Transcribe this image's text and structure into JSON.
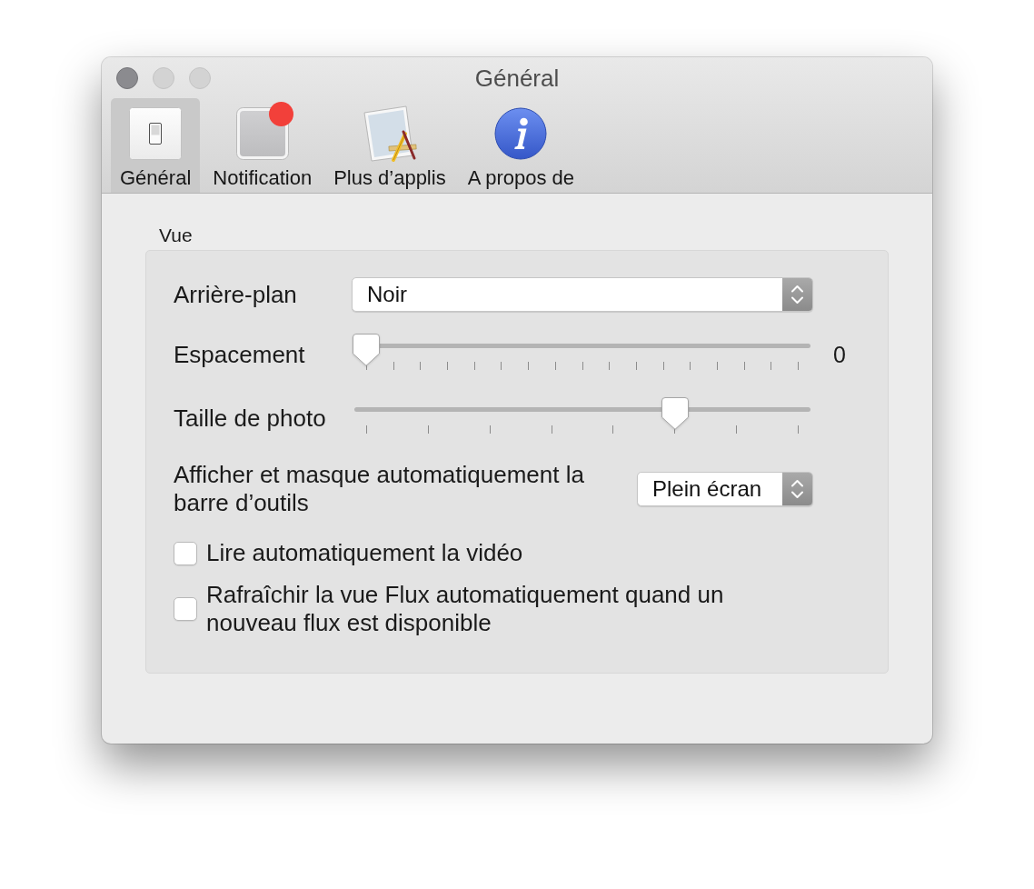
{
  "window": {
    "title": "Général",
    "buttons": [
      {
        "disabled": false
      },
      {
        "disabled": true
      },
      {
        "disabled": true
      }
    ]
  },
  "toolbar": {
    "tabs": [
      {
        "label": "Général",
        "selected": true,
        "badge": false
      },
      {
        "label": "Notification",
        "selected": false,
        "badge": true
      },
      {
        "label": "Plus d’applis",
        "selected": false,
        "badge": false
      },
      {
        "label": "A propos de",
        "selected": false,
        "badge": false
      }
    ]
  },
  "group": {
    "title": "Vue",
    "rows": [
      {
        "kind": "popup",
        "label": "Arrière-plan",
        "value": "Noir"
      },
      {
        "kind": "slider",
        "label": "Espacement",
        "level": 0,
        "reading": "0"
      },
      {
        "kind": "slider",
        "label": "Taille de photo",
        "level": 0.714
      },
      {
        "kind": "popup",
        "label": "Afficher et masque automatiquement la barre d’outils",
        "value": "Plein écran"
      },
      {
        "kind": "checkbox",
        "label": "Lire automatiquement la vidéo",
        "checked": false
      },
      {
        "kind": "checkbox",
        "label": "Rafraîchir la vue Flux automatiquement quand un nouveau flux est disponible",
        "checked": false
      }
    ]
  }
}
